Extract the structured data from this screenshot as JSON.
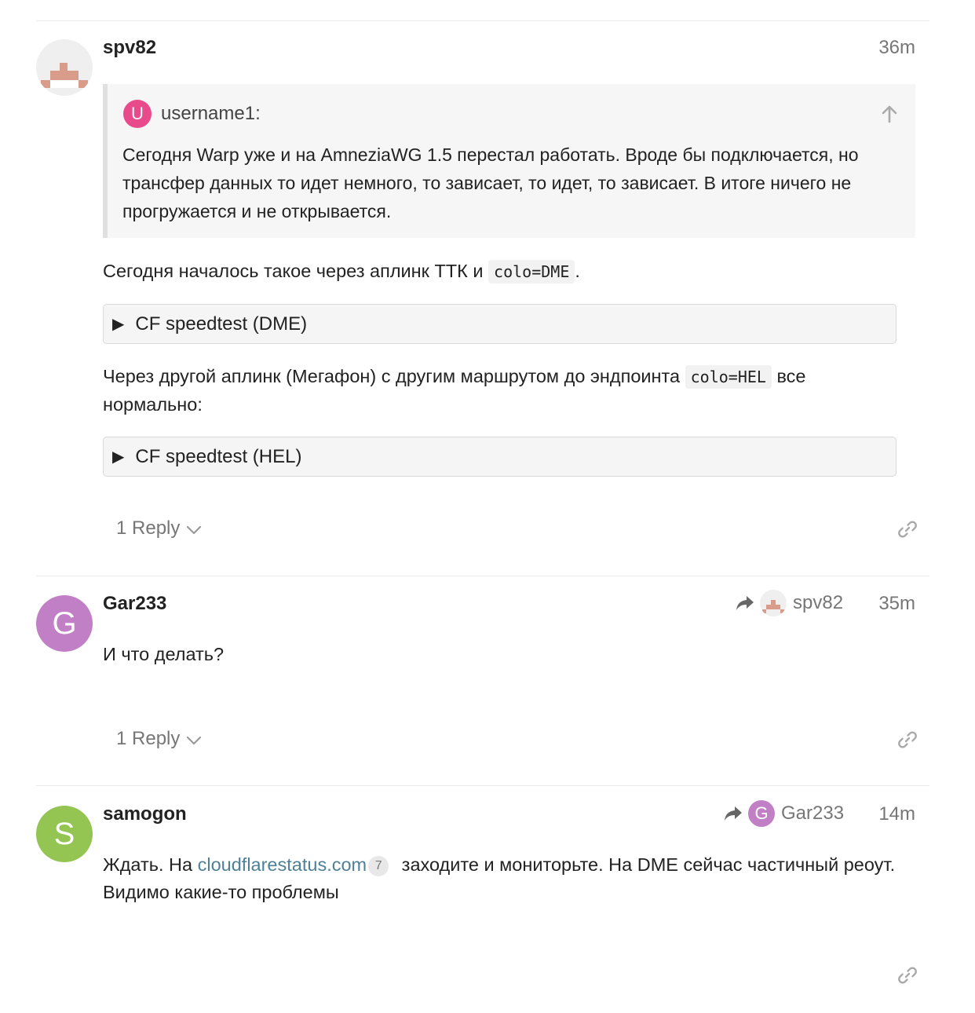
{
  "posts": [
    {
      "username": "spv82",
      "time": "36m",
      "quote": {
        "avatar_letter": "U",
        "username": "username1:",
        "text": "Сегодня Warp уже и на AmneziaWG 1.5 перестал работать. Вроде бы подключается, но трансфер данных то идет немного, то зависает, то идет, то зависает. В итоге ничего не прогружается и не открывается."
      },
      "para1_before": "Сегодня началось такое через аплинк ТТК и ",
      "para1_code": "colo=DME",
      "para1_after": ".",
      "details1": "CF speedtest (DME)",
      "para2_before": "Через другой аплинк (Мегафон) с другим маршрутом до эндпоинта ",
      "para2_code": "colo=HEL",
      "para2_after": " все нормально:",
      "details2": "CF speedtest (HEL)",
      "replies": "1 Reply"
    },
    {
      "username": "Gar233",
      "avatar_letter": "G",
      "time": "35m",
      "reply_to": "spv82",
      "text": "И что делать?",
      "replies": "1 Reply"
    },
    {
      "username": "samogon",
      "avatar_letter": "S",
      "time": "14m",
      "reply_to": "Gar233",
      "reply_to_letter": "G",
      "text_before": "Ждать. На ",
      "link": "cloudflarestatus.com",
      "link_clicks": "7",
      "text_after": " заходите и мониторьте. На DME сейчас частичный реоут. Видимо какие-то проблемы"
    }
  ],
  "icons": {
    "link": "link-icon",
    "reply_arrow": "share-arrow-icon",
    "expand": "chevron-down-icon",
    "jump_up": "arrow-up-icon",
    "details": "triangle-right-icon"
  },
  "colors": {
    "gar_avatar": "#c17fc6",
    "samogon_avatar": "#94c451",
    "quote_avatar": "#e84a8b",
    "link": "#4f8098"
  }
}
